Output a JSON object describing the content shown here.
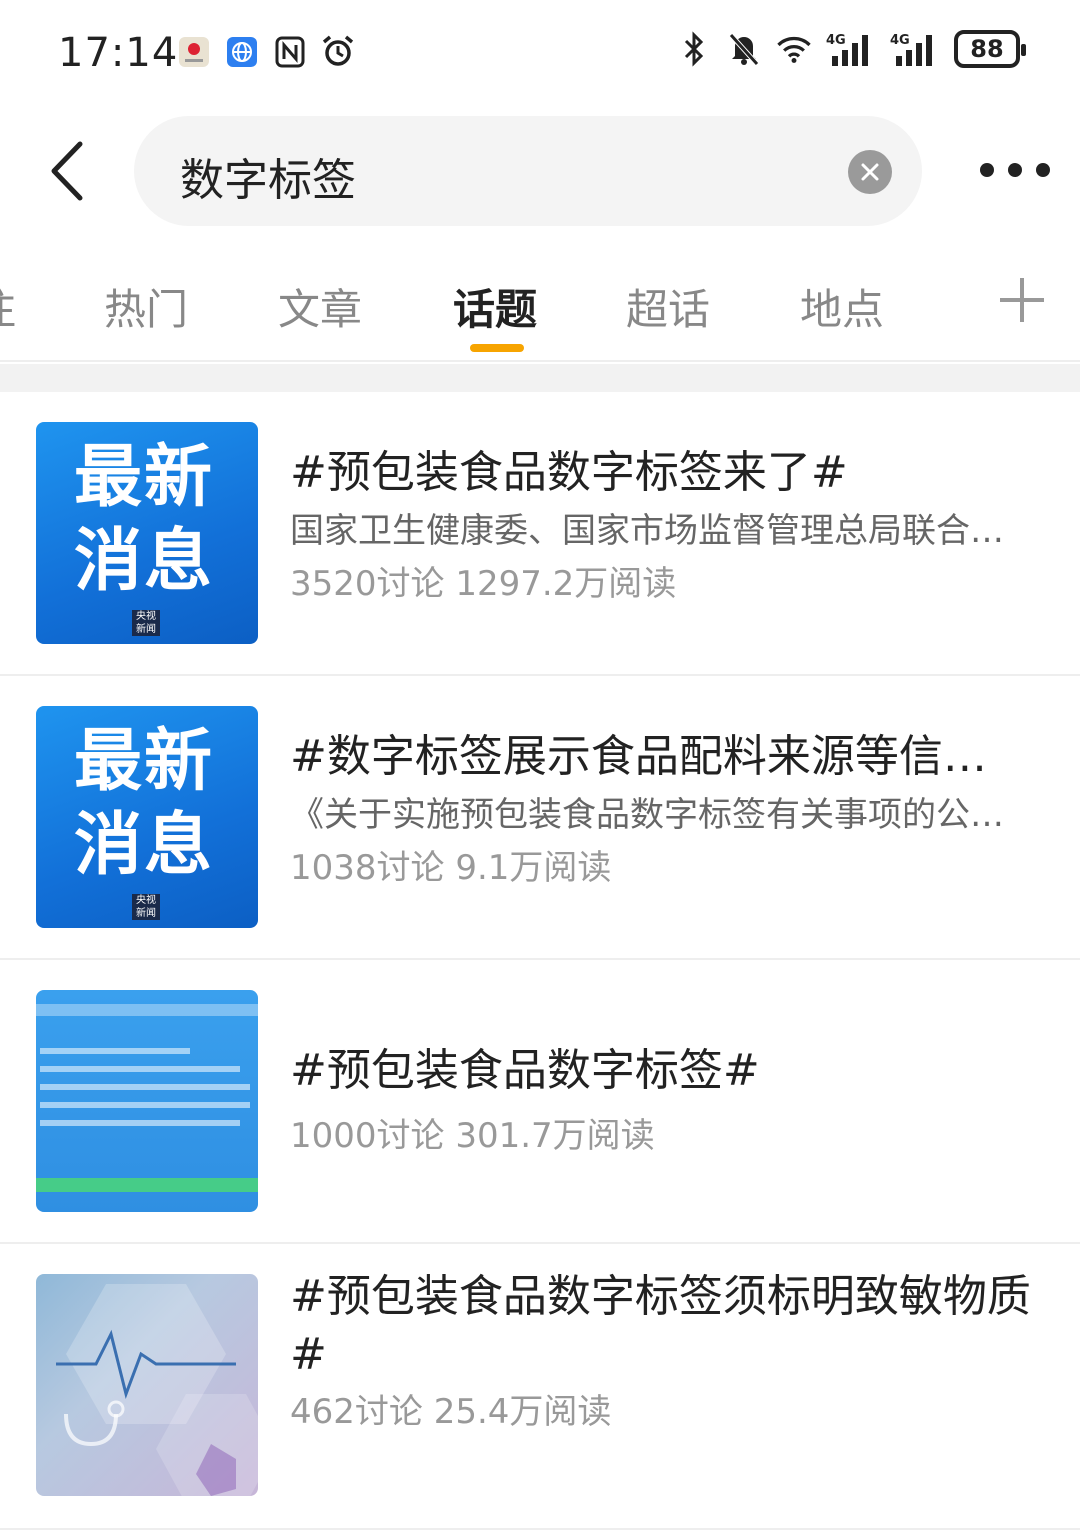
{
  "status_bar": {
    "time": "17:14",
    "battery": "88",
    "left_icons": [
      "huawei-app-icon",
      "globe-app-icon",
      "nfc-icon",
      "alarm-icon"
    ],
    "right_icons": [
      "bluetooth-icon",
      "mute-icon",
      "wifi-icon",
      "signal-4g-icon",
      "signal-4g-icon"
    ]
  },
  "search": {
    "query": "数字标签"
  },
  "tabs": [
    {
      "label": "注",
      "active": false
    },
    {
      "label": "热门",
      "active": false
    },
    {
      "label": "文章",
      "active": false
    },
    {
      "label": "话题",
      "active": true
    },
    {
      "label": "超话",
      "active": false
    },
    {
      "label": "地点",
      "active": false
    }
  ],
  "colors": {
    "accent": "#f7a400",
    "thumb_blue": "#1a7fe6"
  },
  "topics": [
    {
      "title": "#预包装食品数字标签来了#",
      "desc": "国家卫生健康委、国家市场监督管理总局联合…",
      "meta": "3520讨论 1297.2万阅读",
      "thumb": {
        "type": "news",
        "line1": "最新",
        "line2": "消息",
        "logo": "央视新闻"
      }
    },
    {
      "title": "#数字标签展示食品配料来源等信…",
      "desc": "《关于实施预包装食品数字标签有关事项的公…",
      "meta": "1038讨论 9.1万阅读",
      "thumb": {
        "type": "news",
        "line1": "最新",
        "line2": "消息",
        "logo": "央视新闻"
      }
    },
    {
      "title": "#预包装食品数字标签#",
      "desc": "",
      "meta": "1000讨论 301.7万阅读",
      "thumb": {
        "type": "doc"
      }
    },
    {
      "title": "#预包装食品数字标签须标明致敏物质#",
      "desc": "",
      "meta": "462讨论 25.4万阅读",
      "thumb": {
        "type": "medical"
      }
    }
  ]
}
